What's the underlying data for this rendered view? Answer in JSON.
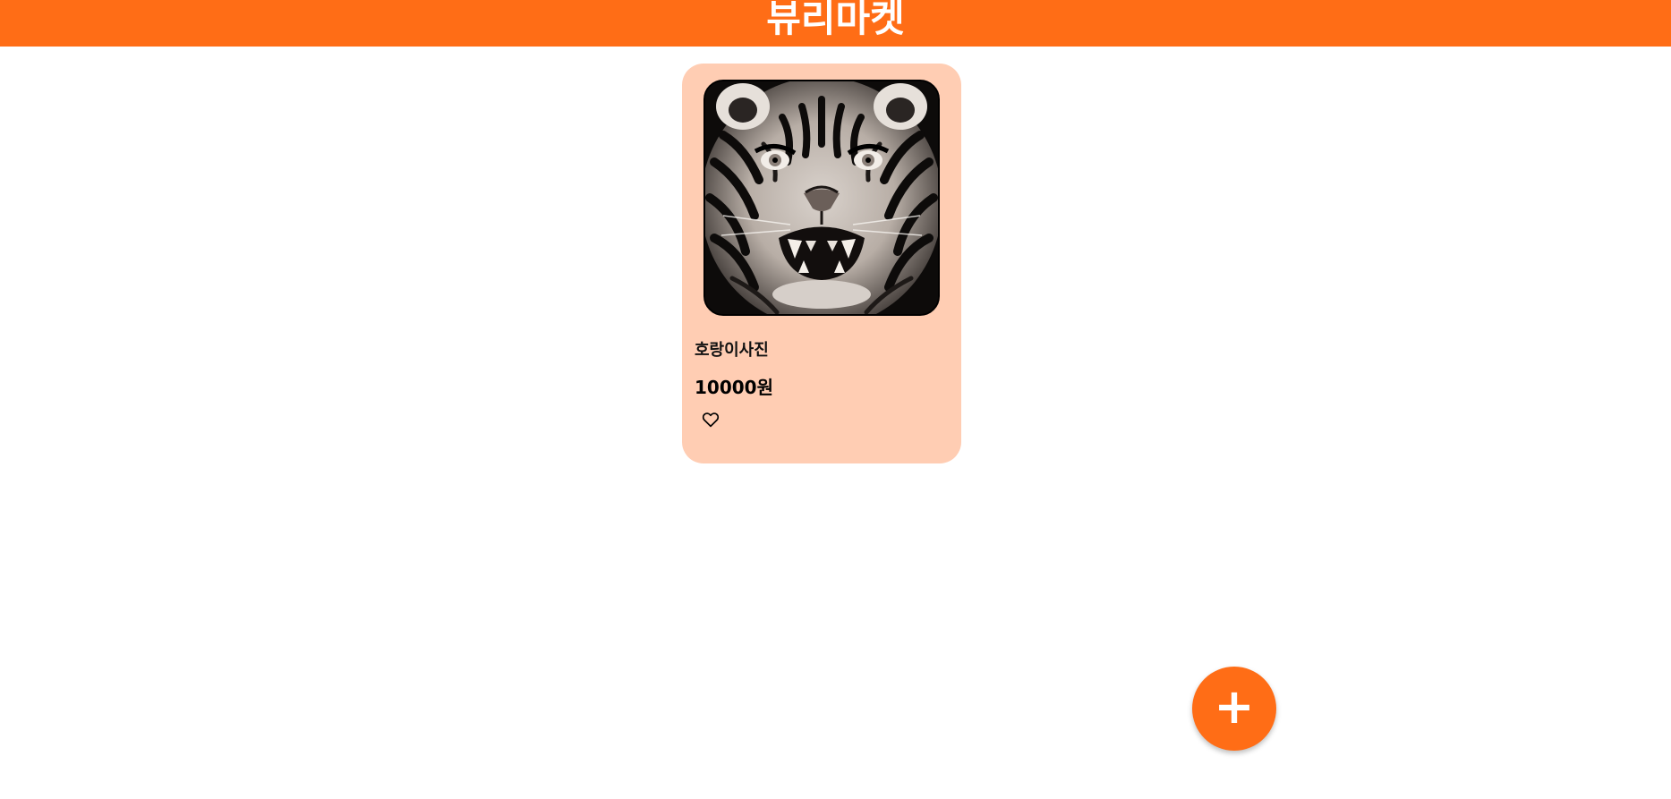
{
  "header": {
    "title": "뷰리마켓"
  },
  "products": [
    {
      "image": "tiger-photo",
      "name": "호랑이사진",
      "price": "10000원",
      "liked": false
    }
  ],
  "fab": {
    "label": "+"
  },
  "colors": {
    "brand": "#ff6d16",
    "card_background": "#ffcdb3",
    "header_text": "#ffffff"
  },
  "icons": {
    "like": "heart-outline-icon",
    "add": "plus-icon"
  }
}
